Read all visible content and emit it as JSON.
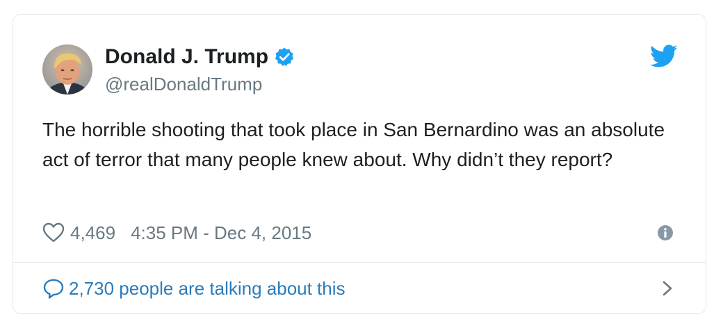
{
  "tweet": {
    "author": {
      "display_name": "Donald J. Trump",
      "handle": "@realDonaldTrump",
      "verified": true
    },
    "text": "The horrible shooting that took place in San Bernardino was an absolute act of terror that many people knew about. Why didn’t they report?",
    "likes": "4,469",
    "timestamp": "4:35 PM - Dec 4, 2015",
    "conversation": "2,730 people are talking about this"
  },
  "icons": {
    "brand": "twitter-bird-icon",
    "verified": "verified-badge-icon",
    "like": "heart-icon",
    "info": "info-icon",
    "reply": "speech-bubble-icon",
    "more": "chevron-right-icon"
  },
  "colors": {
    "twitter_blue": "#1da1f2",
    "link_blue": "#2b7bb9",
    "meta_gray": "#697882",
    "text": "#1c2022",
    "border": "#e1e8ed"
  }
}
